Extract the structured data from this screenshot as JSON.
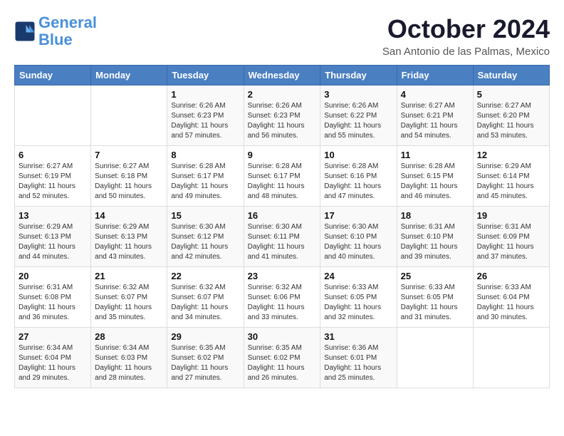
{
  "header": {
    "logo_line1": "General",
    "logo_line2": "Blue",
    "month": "October 2024",
    "location": "San Antonio de las Palmas, Mexico"
  },
  "weekdays": [
    "Sunday",
    "Monday",
    "Tuesday",
    "Wednesday",
    "Thursday",
    "Friday",
    "Saturday"
  ],
  "weeks": [
    [
      {
        "day": "",
        "info": ""
      },
      {
        "day": "",
        "info": ""
      },
      {
        "day": "1",
        "info": "Sunrise: 6:26 AM\nSunset: 6:23 PM\nDaylight: 11 hours and 57 minutes."
      },
      {
        "day": "2",
        "info": "Sunrise: 6:26 AM\nSunset: 6:23 PM\nDaylight: 11 hours and 56 minutes."
      },
      {
        "day": "3",
        "info": "Sunrise: 6:26 AM\nSunset: 6:22 PM\nDaylight: 11 hours and 55 minutes."
      },
      {
        "day": "4",
        "info": "Sunrise: 6:27 AM\nSunset: 6:21 PM\nDaylight: 11 hours and 54 minutes."
      },
      {
        "day": "5",
        "info": "Sunrise: 6:27 AM\nSunset: 6:20 PM\nDaylight: 11 hours and 53 minutes."
      }
    ],
    [
      {
        "day": "6",
        "info": "Sunrise: 6:27 AM\nSunset: 6:19 PM\nDaylight: 11 hours and 52 minutes."
      },
      {
        "day": "7",
        "info": "Sunrise: 6:27 AM\nSunset: 6:18 PM\nDaylight: 11 hours and 50 minutes."
      },
      {
        "day": "8",
        "info": "Sunrise: 6:28 AM\nSunset: 6:17 PM\nDaylight: 11 hours and 49 minutes."
      },
      {
        "day": "9",
        "info": "Sunrise: 6:28 AM\nSunset: 6:17 PM\nDaylight: 11 hours and 48 minutes."
      },
      {
        "day": "10",
        "info": "Sunrise: 6:28 AM\nSunset: 6:16 PM\nDaylight: 11 hours and 47 minutes."
      },
      {
        "day": "11",
        "info": "Sunrise: 6:28 AM\nSunset: 6:15 PM\nDaylight: 11 hours and 46 minutes."
      },
      {
        "day": "12",
        "info": "Sunrise: 6:29 AM\nSunset: 6:14 PM\nDaylight: 11 hours and 45 minutes."
      }
    ],
    [
      {
        "day": "13",
        "info": "Sunrise: 6:29 AM\nSunset: 6:13 PM\nDaylight: 11 hours and 44 minutes."
      },
      {
        "day": "14",
        "info": "Sunrise: 6:29 AM\nSunset: 6:13 PM\nDaylight: 11 hours and 43 minutes."
      },
      {
        "day": "15",
        "info": "Sunrise: 6:30 AM\nSunset: 6:12 PM\nDaylight: 11 hours and 42 minutes."
      },
      {
        "day": "16",
        "info": "Sunrise: 6:30 AM\nSunset: 6:11 PM\nDaylight: 11 hours and 41 minutes."
      },
      {
        "day": "17",
        "info": "Sunrise: 6:30 AM\nSunset: 6:10 PM\nDaylight: 11 hours and 40 minutes."
      },
      {
        "day": "18",
        "info": "Sunrise: 6:31 AM\nSunset: 6:10 PM\nDaylight: 11 hours and 39 minutes."
      },
      {
        "day": "19",
        "info": "Sunrise: 6:31 AM\nSunset: 6:09 PM\nDaylight: 11 hours and 37 minutes."
      }
    ],
    [
      {
        "day": "20",
        "info": "Sunrise: 6:31 AM\nSunset: 6:08 PM\nDaylight: 11 hours and 36 minutes."
      },
      {
        "day": "21",
        "info": "Sunrise: 6:32 AM\nSunset: 6:07 PM\nDaylight: 11 hours and 35 minutes."
      },
      {
        "day": "22",
        "info": "Sunrise: 6:32 AM\nSunset: 6:07 PM\nDaylight: 11 hours and 34 minutes."
      },
      {
        "day": "23",
        "info": "Sunrise: 6:32 AM\nSunset: 6:06 PM\nDaylight: 11 hours and 33 minutes."
      },
      {
        "day": "24",
        "info": "Sunrise: 6:33 AM\nSunset: 6:05 PM\nDaylight: 11 hours and 32 minutes."
      },
      {
        "day": "25",
        "info": "Sunrise: 6:33 AM\nSunset: 6:05 PM\nDaylight: 11 hours and 31 minutes."
      },
      {
        "day": "26",
        "info": "Sunrise: 6:33 AM\nSunset: 6:04 PM\nDaylight: 11 hours and 30 minutes."
      }
    ],
    [
      {
        "day": "27",
        "info": "Sunrise: 6:34 AM\nSunset: 6:04 PM\nDaylight: 11 hours and 29 minutes."
      },
      {
        "day": "28",
        "info": "Sunrise: 6:34 AM\nSunset: 6:03 PM\nDaylight: 11 hours and 28 minutes."
      },
      {
        "day": "29",
        "info": "Sunrise: 6:35 AM\nSunset: 6:02 PM\nDaylight: 11 hours and 27 minutes."
      },
      {
        "day": "30",
        "info": "Sunrise: 6:35 AM\nSunset: 6:02 PM\nDaylight: 11 hours and 26 minutes."
      },
      {
        "day": "31",
        "info": "Sunrise: 6:36 AM\nSunset: 6:01 PM\nDaylight: 11 hours and 25 minutes."
      },
      {
        "day": "",
        "info": ""
      },
      {
        "day": "",
        "info": ""
      }
    ]
  ]
}
